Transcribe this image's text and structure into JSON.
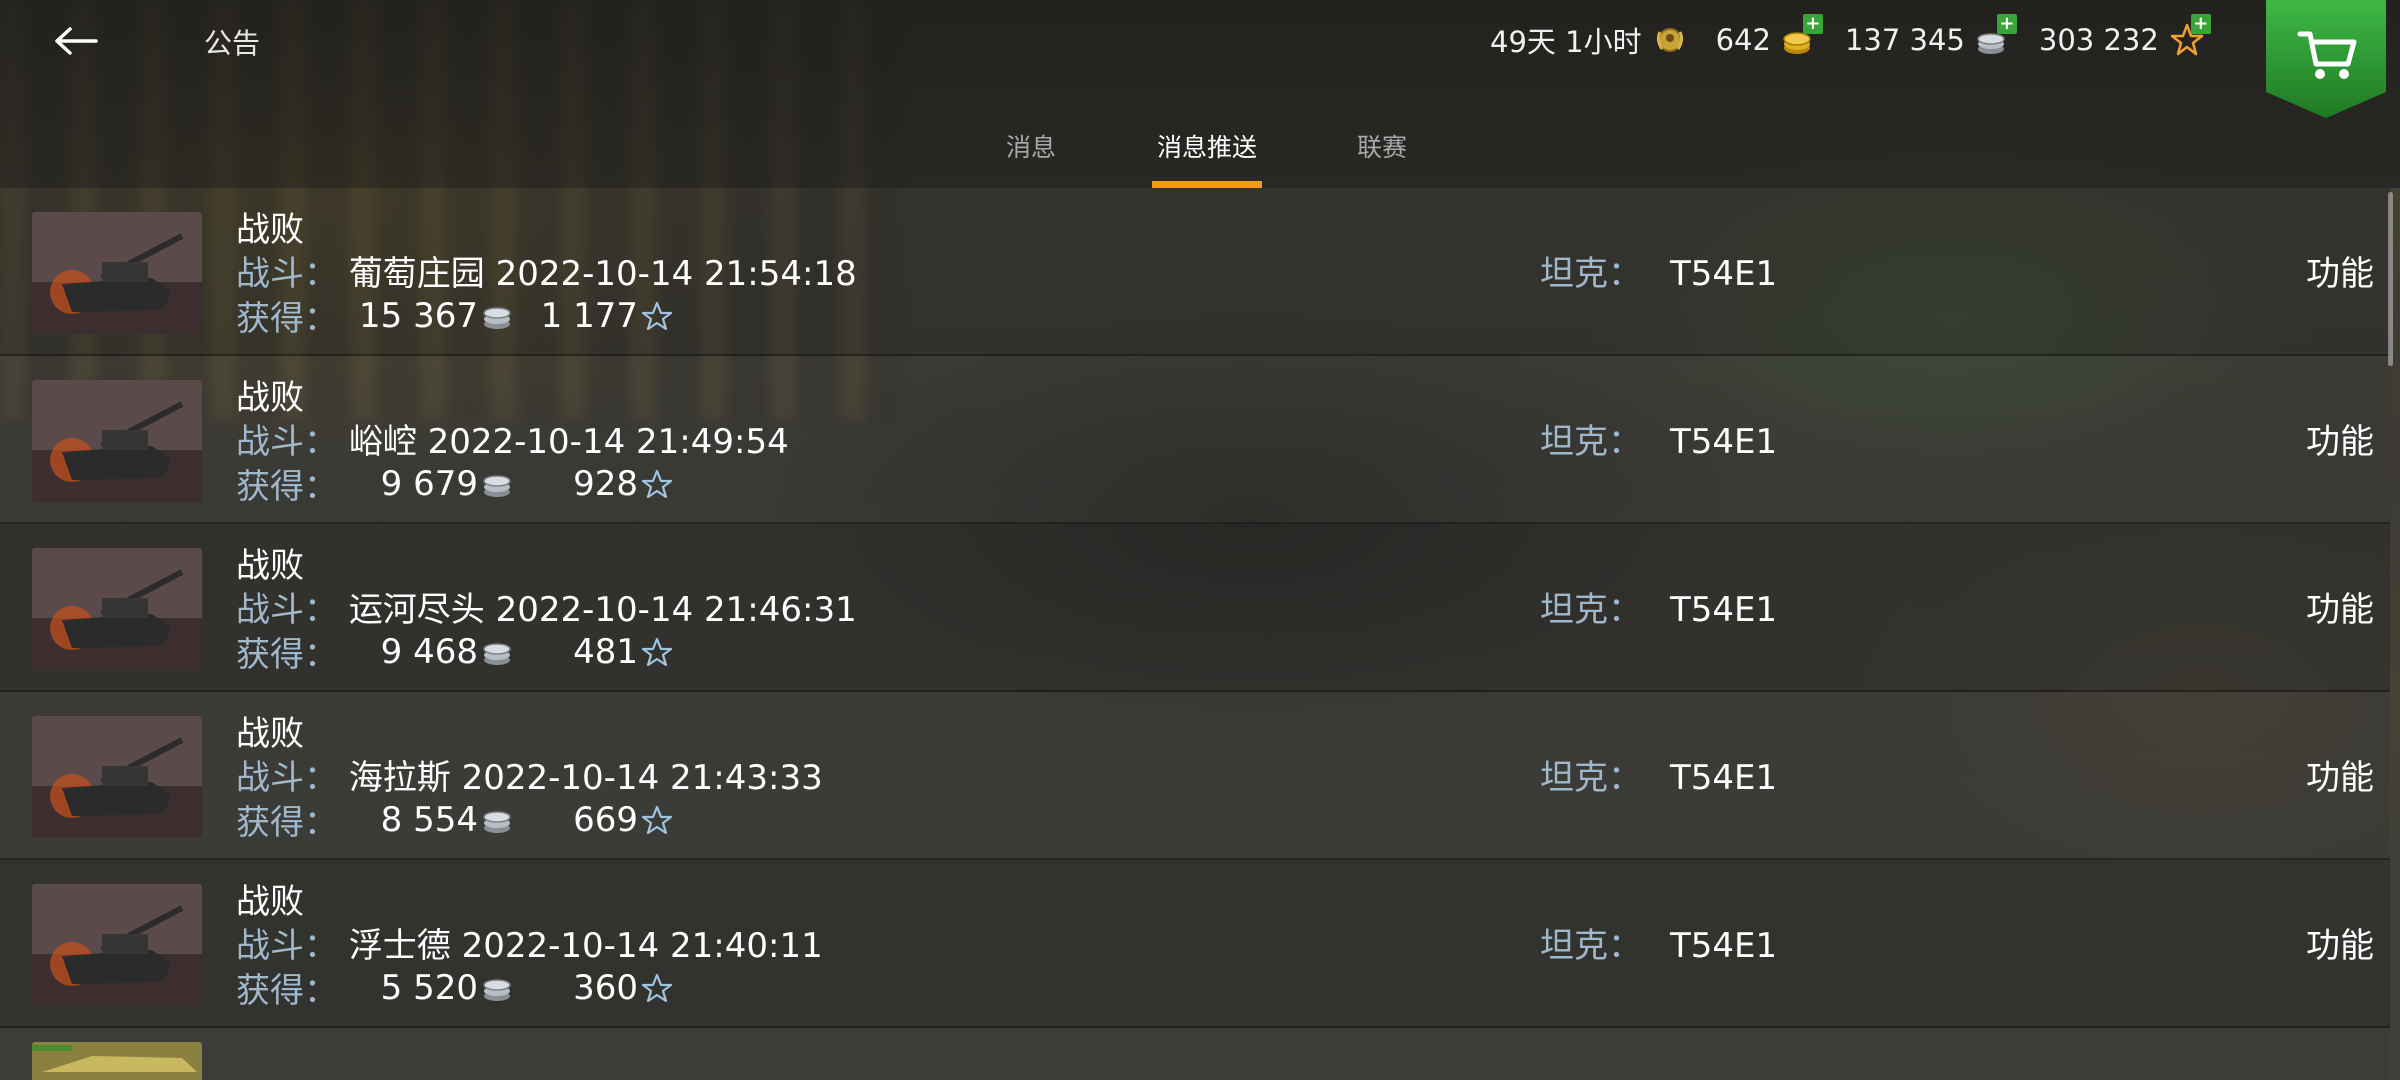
{
  "header": {
    "title": "公告",
    "back_icon": "arrow-left-icon",
    "premium": {
      "value": "49天 1小时",
      "icon": "premium-laurel-icon"
    },
    "gold": {
      "value": "642",
      "icon": "gold-coins-icon"
    },
    "credits": {
      "value": "137 345",
      "icon": "silver-coins-icon"
    },
    "free_xp": {
      "value": "303 232",
      "icon": "star-icon"
    },
    "shop_icon": "shopping-cart-icon"
  },
  "tabs": [
    {
      "label": "消息",
      "active": false
    },
    {
      "label": "消息推送",
      "active": true
    },
    {
      "label": "联赛",
      "active": false
    }
  ],
  "labels": {
    "battle": "战斗：",
    "earned": "获得：",
    "tank": "坦克：",
    "func": "功能"
  },
  "rows": [
    {
      "result": "战败",
      "map_time": "葡萄庄园 2022-10-14 21:54:18",
      "credits": "15 367",
      "xp": "1 177",
      "tank": "T54E1"
    },
    {
      "result": "战败",
      "map_time": "峪崆 2022-10-14 21:49:54",
      "credits": "9 679",
      "xp": "928",
      "tank": "T54E1"
    },
    {
      "result": "战败",
      "map_time": "运河尽头 2022-10-14 21:46:31",
      "credits": "9 468",
      "xp": "481",
      "tank": "T54E1"
    },
    {
      "result": "战败",
      "map_time": "海拉斯 2022-10-14 21:43:33",
      "credits": "8 554",
      "xp": "669",
      "tank": "T54E1"
    },
    {
      "result": "战败",
      "map_time": "浮士德 2022-10-14 21:40:11",
      "credits": "5 520",
      "xp": "360",
      "tank": "T54E1"
    }
  ],
  "colors": {
    "accent": "#f59a1c",
    "label": "#9fb8cc",
    "shop_green": "#2e9b34"
  }
}
